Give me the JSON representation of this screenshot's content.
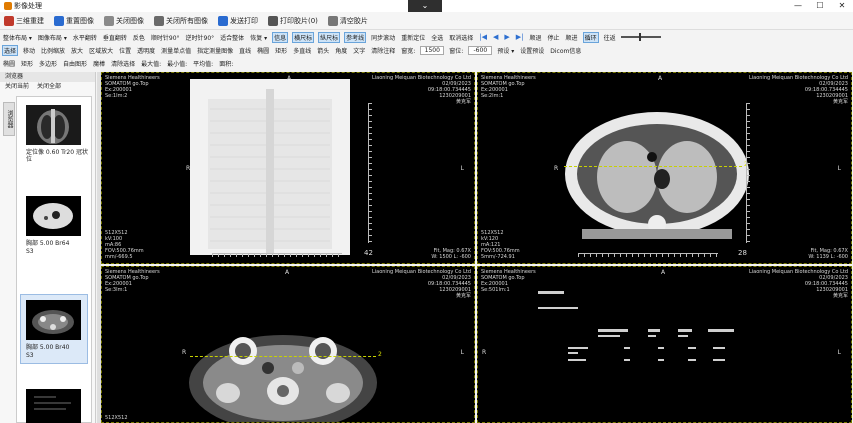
{
  "window": {
    "title": "影像处理",
    "chevron": "⌄",
    "min": "—",
    "max": "☐",
    "close": "✕"
  },
  "toolbar1": [
    {
      "label": "三维重建",
      "color": "#c0392b"
    },
    {
      "label": "重置图像",
      "color": "#2a6bd0"
    },
    {
      "label": "关闭图像",
      "color": "#8a8a8a"
    },
    {
      "label": "关闭所有图像",
      "color": "#6a6a6a"
    },
    {
      "label": "发送打印",
      "color": "#2a6bd0"
    },
    {
      "label": "打印胶片(0)",
      "color": "#555"
    },
    {
      "label": "清空胶片",
      "color": "#777"
    }
  ],
  "toolbar2": {
    "items": [
      "整体布局 ▾",
      "图像布局 ▾",
      "水平翻转",
      "垂直翻转",
      "反色",
      "顺时针90°",
      "逆时针90°",
      "适合整体",
      "恢复 ▾"
    ],
    "toggles": [
      "信息",
      "横尺标",
      "纵尺标",
      "参考线"
    ],
    "more": [
      "同步滚动",
      "重新定位",
      "全选",
      "取消选择"
    ],
    "nav": [
      "|◀",
      "◀",
      "▶",
      "▶|"
    ],
    "play": [
      "顺退",
      "停止",
      "顺进"
    ],
    "loop": "循环",
    "span": "往返"
  },
  "toolbar3": {
    "items": [
      "选择",
      "移动",
      "比例缩放",
      "放大",
      "区域放大",
      "位置",
      "透明度",
      "测量单点值",
      "指定测量图像",
      "直线",
      "椭圆",
      "矩形",
      "多直线",
      "箭头",
      "角度",
      "文字",
      "清除注释",
      "窗宽:"
    ],
    "ww": "1500",
    "wl_label": "窗位:",
    "wl": "-600",
    "preset": "预设 ▾",
    "set_preset": "设置预设",
    "dicom": "Dicom信息"
  },
  "toolbar4": [
    "椭圆",
    "矩形",
    "多边形",
    "自由图形",
    "魔棒",
    "清除选择",
    "最大值:",
    "最小值:",
    "平均值:",
    "面积:"
  ],
  "browser": {
    "title": "浏览器",
    "close_current": "关闭当前",
    "close_all": "关闭全部",
    "vtab": "浏览器",
    "items": [
      {
        "label": "定位像 0.60 Tr20 冠状位"
      },
      {
        "label": "胸部 5.00 Br64",
        "sub": "S3"
      },
      {
        "label": "胸部 5.00 Br40",
        "sub": "S3"
      },
      {
        "label": ""
      }
    ]
  },
  "viewers": [
    {
      "tl": [
        "Siemens Healthineers",
        "SOMATOM go.Top",
        "Ex:200001",
        "Se:1Im:2"
      ],
      "tr": [
        "Liaoning Meiquan Biotechnology Co Ltd",
        "02/09/2023",
        "09:18:00.734445",
        "1230209001",
        "黄克军"
      ],
      "bl": [
        "512X512",
        "kV:100",
        "mA:86",
        "FOV:500.76mm",
        "mm/-669.5"
      ],
      "br": [
        "Fit, Mag: 0.67X",
        "W: 1500 L: -600"
      ],
      "top": "A",
      "left": "R",
      "right": "L",
      "bottom": "P"
    },
    {
      "tl": [
        "Siemens Healthineers",
        "SOMATOM go.Top",
        "Ex:200001",
        "Se:2Im:1"
      ],
      "tr": [
        "Liaoning Meiquan Biotechnology Co Ltd",
        "02/09/2023",
        "09:18:00.734445",
        "1230209001",
        "黄克军"
      ],
      "bl": [
        "512X512",
        "kV:120",
        "mA:121",
        "FOV:500.76mm",
        "5mm/-724.91"
      ],
      "br": [
        "Fit, Mag: 0.67X",
        "W: 1139 L: -600"
      ],
      "top": "A",
      "left": "R",
      "right": "L",
      "bottom": "P"
    },
    {
      "tl": [
        "Siemens Healthineers",
        "SOMATOM go.Top",
        "Ex:200001",
        "Se:3Im:1"
      ],
      "tr": [
        "Liaoning Meiquan Biotechnology Co Ltd",
        "02/09/2023",
        "09:18:00.734445",
        "1230209001",
        "黄克军"
      ],
      "bl": [
        "512X512"
      ],
      "br": [],
      "top": "A",
      "left": "R",
      "right": "L",
      "bottom": ""
    },
    {
      "tl": [
        "Siemens Healthineers",
        "SOMATOM go.Top",
        "Ex:200001",
        "Se:501Im:1"
      ],
      "tr": [
        "Liaoning Meiquan Biotechnology Co Ltd",
        "02/09/2023",
        "09:18:00.734445",
        "1230209001",
        "黄克军"
      ],
      "bl": [],
      "br": [],
      "top": "A",
      "left": "R",
      "right": "L",
      "bottom": ""
    }
  ],
  "ref_line_label": "2",
  "slice_numbers": [
    "42",
    "28"
  ]
}
